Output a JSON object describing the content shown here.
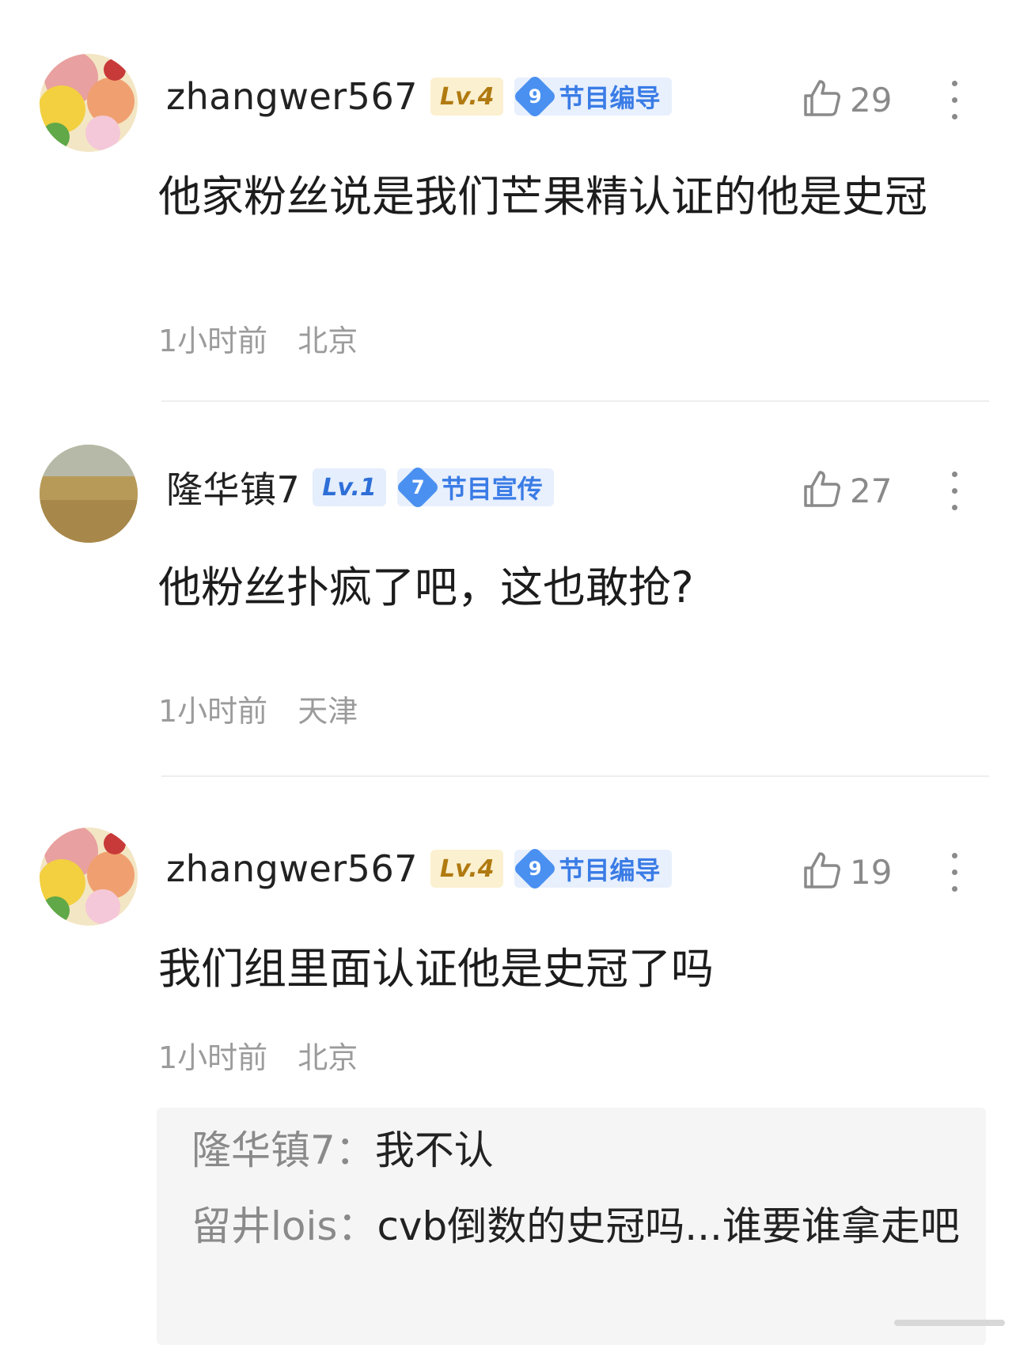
{
  "comments": [
    {
      "username": "zhangwer567",
      "level": "Lv.4",
      "role_number": "9",
      "role": "节目编导",
      "likes": "29",
      "text": "他家粉丝说是我们芒果精认证的他是史冠",
      "time": "1小时前",
      "location": "北京"
    },
    {
      "username": "隆华镇7",
      "level": "Lv.1",
      "role_number": "7",
      "role": "节目宣传",
      "likes": "27",
      "text": "他粉丝扑疯了吧，这也敢抢?",
      "time": "1小时前",
      "location": "天津"
    },
    {
      "username": "zhangwer567",
      "level": "Lv.4",
      "role_number": "9",
      "role": "节目编导",
      "likes": "19",
      "text": "我们组里面认证他是史冠了吗",
      "time": "1小时前",
      "location": "北京"
    }
  ],
  "replies": [
    {
      "name": "隆华镇7：",
      "text": "我不认"
    },
    {
      "name": "留井lois：",
      "text": "cvb倒数的史冠吗...谁要谁拿走吧"
    }
  ],
  "icons": {
    "like": "thumb-up-icon",
    "more": "more-vertical-icon"
  },
  "colors": {
    "gold_badge": "#fbf0cf",
    "blue_badge": "#e8f0fd",
    "meta_gray": "#9b9b9b"
  }
}
